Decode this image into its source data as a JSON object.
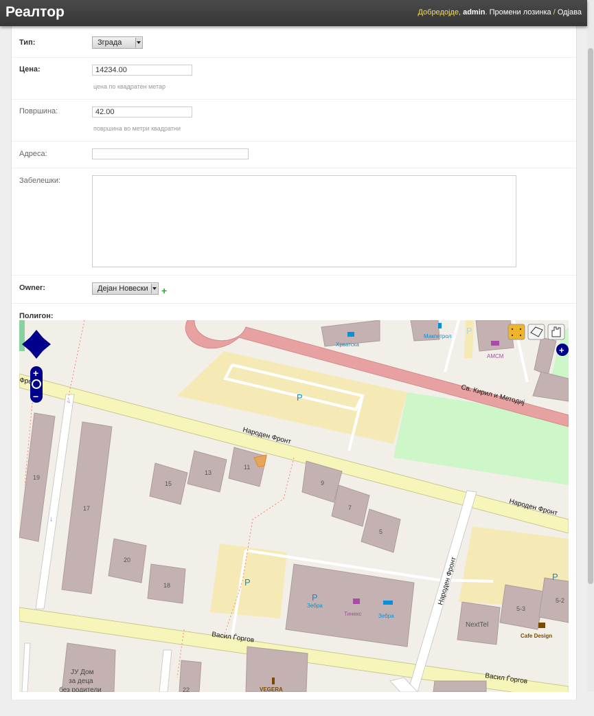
{
  "header": {
    "brand": "Реалтор",
    "welcome": "Добредојде, ",
    "username": "admin",
    "sep1": ". ",
    "change_password": "Промени лозинка",
    "sep2": " / ",
    "logout": "Одјава"
  },
  "form": {
    "type": {
      "label": "Тип:",
      "value": "Зграда"
    },
    "price": {
      "label": "Цена:",
      "value": "14234.00",
      "help": "цена по квадратен метар"
    },
    "area": {
      "label": "Површина:",
      "value": "42.00",
      "help": "површина во метри квадратни"
    },
    "address": {
      "label": "Адреса:",
      "value": ""
    },
    "notes": {
      "label": "Забелешки:",
      "value": ""
    },
    "owner": {
      "label": "Owner:",
      "value": "Дејан Новески",
      "add_symbol": "+"
    },
    "polygon": {
      "label": "Полигон:"
    }
  },
  "map": {
    "streets": [
      "Св. Кирил и Методиј",
      "Народен Фронт",
      "Народен Фронт",
      "Народен Фронт",
      "Васил Ѓоргов",
      "Васил Ѓоргов",
      "Фронт"
    ],
    "buildings": [
      "19",
      "17",
      "15",
      "13",
      "11",
      "9",
      "7",
      "5",
      "20",
      "18",
      "5-3",
      "5-2",
      "NextTel",
      "22"
    ],
    "pois": [
      "Хрватска",
      "Макпетрол",
      "АМСМ",
      "Зебра",
      "Тинекс",
      "Зебра",
      "Cafe Design",
      "VEGERA"
    ],
    "parking_symbol": "P",
    "school_label": [
      "ЈУ Дом",
      "за деца",
      "без родители"
    ],
    "controls": [
      "pan-control",
      "zoom-in",
      "world",
      "zoom-out",
      "edit-toolbar"
    ],
    "zoom_in_symbol": "+",
    "zoom_out_symbol": "−",
    "layer_switcher_symbol": "+"
  },
  "colors": {
    "primary_road": "#e8a1a1",
    "secondary_road": "#f7f6ba",
    "building": "#c4b2b2",
    "parking": "#f5eab6",
    "grass": "#cdf7c9",
    "ol_blue": "#00008b",
    "polygon_fill": "#f0a24a"
  }
}
